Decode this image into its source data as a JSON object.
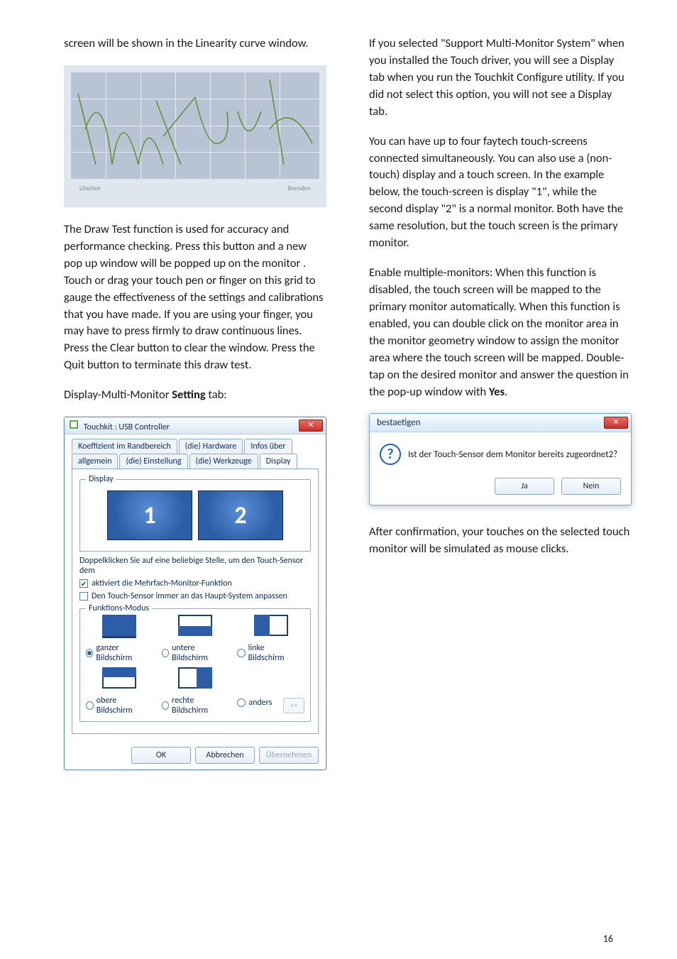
{
  "left": {
    "intro": "screen will be shown in the Linearity curve window.",
    "sig_left_btn": "Löschen",
    "sig_right_btn": "Beenden",
    "drawtest": "The Draw Test function is used for accuracy and performance checking. Press this button and a new pop up window will be popped up on the monitor . Touch or drag your touch pen or finger on this grid to gauge the effectiveness of the settings and calibrations that you have made. If you are using your finger, you may have to press firmly to draw continuous lines. Press the Clear button to clear the window. Press the Quit button to terminate this draw test.",
    "display_heading_pre": "Display-Multi-Monitor ",
    "display_heading_bold": "Setting",
    "display_heading_post": " tab:"
  },
  "dialog": {
    "title": "Touchkit : USB Controller",
    "tabs_row1": [
      "Koeffizient im Randbereich",
      "(die) Hardware",
      "Infos über"
    ],
    "tabs_row2": [
      "allgemein",
      "(die) Einstellung",
      "(die) Werkzeuge",
      "Display"
    ],
    "group_display": "Display",
    "mon1": "1",
    "mon2": "2",
    "hint": "Doppelklicken Sie auf eine beliebige Stelle, um den Touch-Sensor dem",
    "chk_multi": "aktiviert die Mehrfach-Monitor-Funktion",
    "chk_main": "Den Touch-Sensor immer an das Haupt-System anpassen",
    "group_mode": "Funktions-Modus",
    "radios": [
      "ganzer Bildschirm",
      "untere Bildschirm",
      "linke Bildschirm",
      "obere Bildschirm",
      "rechte Bildschirm",
      "anders"
    ],
    "arrow": ">>",
    "ok": "OK",
    "cancel": "Abbrechen",
    "apply": "Übernehmen"
  },
  "right": {
    "p1": "If you selected \"Support Multi-Monitor System\" when you installed the Touch driver, you will see a Display tab when you run the Touchkit Configure utility. If you did not select this option, you will not see a Display tab.",
    "p2": "You can have up to four faytech touch-screens connected simultaneously. You can also use a (non-touch) display and a touch screen. In the example below, the touch-screen is display \"1\", while the second display \"2\" is a normal monitor. Both have the same resolution, but the touch screen is the primary monitor.",
    "p3_pre": "Enable multiple-monitors: When this function is disabled, the touch screen will be mapped to the primary monitor automatically. When this function is enabled, you can double click on the monitor area in the monitor geometry window to assign the monitor area where the touch screen will be mapped. Double-tap on the desired monitor and answer the question in the pop-up window with ",
    "p3_bold": "Yes",
    "p3_post": ".",
    "p4": "After confirmation, your touches on the selected touch monitor will be simulated as mouse clicks."
  },
  "msg": {
    "title": "bestaetigen",
    "text": "Ist der Touch-Sensor dem Monitor bereits zugeordnet2?",
    "yes": "Ja",
    "no": "Nein"
  },
  "page_number": "16"
}
